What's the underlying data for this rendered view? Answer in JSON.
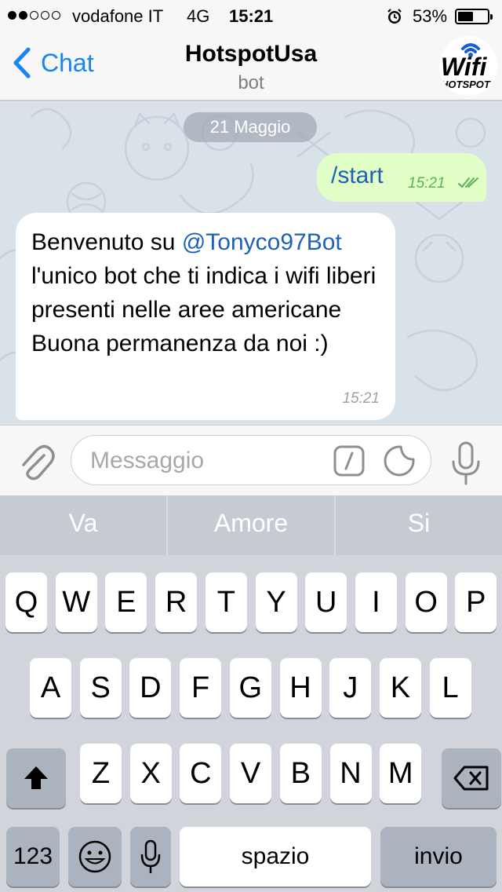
{
  "status_bar": {
    "carrier": "vodafone IT",
    "network": "4G",
    "time": "15:21",
    "battery_percent": "53%",
    "battery_level": 0.53,
    "signal_bars_filled": 2,
    "signal_bars_total": 5
  },
  "nav": {
    "back_label": "Chat",
    "title": "HotspotUsa",
    "subtitle": "bot",
    "avatar_text_top": "Wifi",
    "avatar_text_bottom": "HOTSPOT"
  },
  "chat": {
    "date_label": "21 Maggio",
    "outgoing": {
      "text": "/start",
      "time": "15:21"
    },
    "incoming": {
      "text_prefix": "Benvenuto su ",
      "mention": "@Tonyco97Bot",
      "text_body": "l'unico bot che ti indica i wifi liberi presenti nelle aree americane",
      "text_closing": "Buona permanenza da noi :)",
      "time": "15:21"
    }
  },
  "input": {
    "placeholder": "Messaggio",
    "value": ""
  },
  "keyboard": {
    "suggestions": [
      "Va",
      "Amore",
      "Si"
    ],
    "row1": [
      "Q",
      "W",
      "E",
      "R",
      "T",
      "Y",
      "U",
      "I",
      "O",
      "P"
    ],
    "row2": [
      "A",
      "S",
      "D",
      "F",
      "G",
      "H",
      "J",
      "K",
      "L"
    ],
    "row3": [
      "Z",
      "X",
      "C",
      "V",
      "B",
      "N",
      "M"
    ],
    "numbers_label": "123",
    "space_label": "spazio",
    "return_label": "invio"
  },
  "colors": {
    "accent": "#1a84f2",
    "outgoing_bubble": "#e1fec6",
    "incoming_bubble": "#ffffff",
    "chat_background": "#d9e1e9"
  },
  "icons": {
    "back": "chevron-left-icon",
    "attach": "paperclip-icon",
    "command": "slash-command-icon",
    "sticker": "sticker-icon",
    "mic": "microphone-icon",
    "shift": "shift-arrow-icon",
    "delete": "backspace-icon",
    "emoji": "emoji-icon",
    "dictation": "microphone-icon",
    "read_receipt": "double-check-icon",
    "alarm": "alarm-clock-icon"
  }
}
